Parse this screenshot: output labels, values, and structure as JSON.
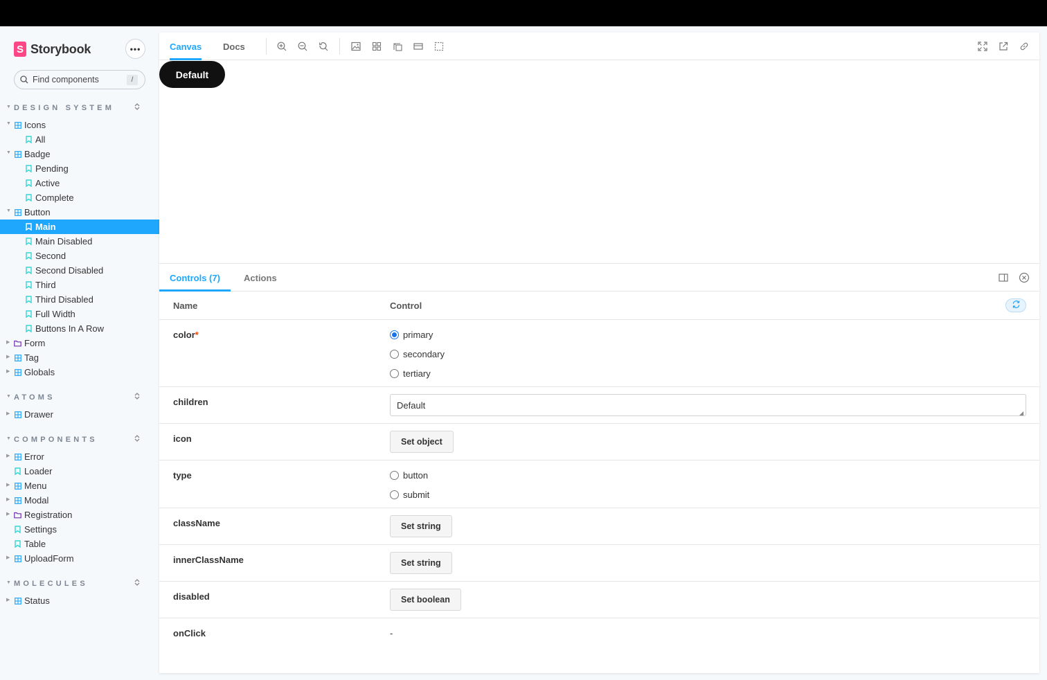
{
  "sidebar": {
    "brand": "Storybook",
    "brand_logo": "S",
    "more": "•••",
    "search_placeholder": "Find components",
    "search_shortcut": "/",
    "groups": [
      {
        "title": "DESIGN SYSTEM",
        "items": [
          {
            "label": "Icons",
            "kind": "component",
            "expanded": true
          },
          {
            "label": "All",
            "kind": "story"
          },
          {
            "label": "Badge",
            "kind": "component",
            "expanded": true
          },
          {
            "label": "Pending",
            "kind": "story"
          },
          {
            "label": "Active",
            "kind": "story"
          },
          {
            "label": "Complete",
            "kind": "story"
          },
          {
            "label": "Button",
            "kind": "component",
            "expanded": true
          },
          {
            "label": "Main",
            "kind": "story",
            "selected": true
          },
          {
            "label": "Main Disabled",
            "kind": "story"
          },
          {
            "label": "Second",
            "kind": "story"
          },
          {
            "label": "Second Disabled",
            "kind": "story"
          },
          {
            "label": "Third",
            "kind": "story"
          },
          {
            "label": "Third Disabled",
            "kind": "story"
          },
          {
            "label": "Full Width",
            "kind": "story"
          },
          {
            "label": "Buttons In A Row",
            "kind": "story"
          },
          {
            "label": "Form",
            "kind": "folder"
          },
          {
            "label": "Tag",
            "kind": "component"
          },
          {
            "label": "Globals",
            "kind": "component"
          }
        ]
      },
      {
        "title": "ATOMS",
        "items": [
          {
            "label": "Drawer",
            "kind": "component"
          }
        ]
      },
      {
        "title": "COMPONENTS",
        "items": [
          {
            "label": "Error",
            "kind": "component"
          },
          {
            "label": "Loader",
            "kind": "story-root"
          },
          {
            "label": "Menu",
            "kind": "component"
          },
          {
            "label": "Modal",
            "kind": "component"
          },
          {
            "label": "Registration",
            "kind": "folder"
          },
          {
            "label": "Settings",
            "kind": "story-root"
          },
          {
            "label": "Table",
            "kind": "story-root"
          },
          {
            "label": "UploadForm",
            "kind": "component"
          }
        ]
      },
      {
        "title": "MOLECULES",
        "items": [
          {
            "label": "Status",
            "kind": "component"
          }
        ]
      }
    ]
  },
  "toolbar": {
    "tabs": [
      "Canvas",
      "Docs"
    ],
    "active_tab": "Canvas",
    "tools": [
      "zoom-in-icon",
      "zoom-out-icon",
      "zoom-reset-icon",
      "background-icon",
      "grid-icon",
      "measure-icon",
      "viewport-icon",
      "outline-icon"
    ],
    "right_tools": [
      "fullscreen-icon",
      "open-new-tab-icon",
      "copy-link-icon"
    ]
  },
  "canvas": {
    "button_label": "Default"
  },
  "panel": {
    "tabs": [
      "Controls (7)",
      "Actions"
    ],
    "active_tab": "Controls (7)",
    "columns": {
      "name": "Name",
      "control": "Control"
    },
    "rows": [
      {
        "name": "color",
        "required": true,
        "control": "radio",
        "options": [
          "primary",
          "secondary",
          "tertiary"
        ],
        "selected": "primary"
      },
      {
        "name": "children",
        "control": "text",
        "value": "Default"
      },
      {
        "name": "icon",
        "control": "button",
        "button": "Set object"
      },
      {
        "name": "type",
        "control": "radio",
        "options": [
          "button",
          "submit"
        ],
        "selected": ""
      },
      {
        "name": "className",
        "control": "button",
        "button": "Set string"
      },
      {
        "name": "innerClassName",
        "control": "button",
        "button": "Set string"
      },
      {
        "name": "disabled",
        "control": "button",
        "button": "Set boolean"
      },
      {
        "name": "onClick",
        "control": "none",
        "value": "-"
      }
    ],
    "required_mark": "*"
  },
  "colors": {
    "accent": "#1ea7fd",
    "brand": "#ff4785",
    "component_icon": "#1ea7fd",
    "story_icon": "#37d5d3",
    "folder_icon": "#6f2cac"
  }
}
